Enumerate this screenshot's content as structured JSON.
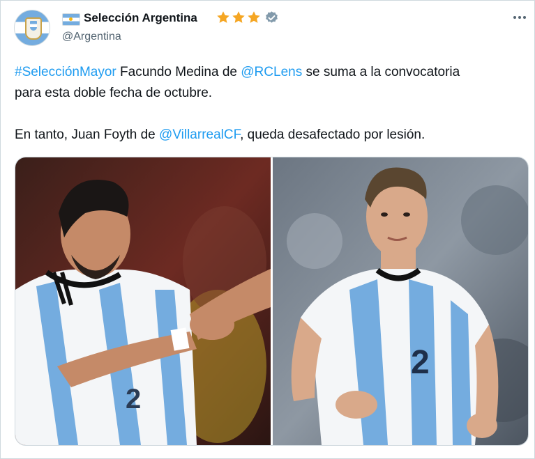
{
  "author": {
    "display_name": "Selección Argentina",
    "handle": "@Argentina",
    "stars": 3,
    "avatar_icon": "afa-crest-icon",
    "flag_icon": "argentina-flag-icon",
    "verified_icon": "verified-badge-icon"
  },
  "menu": {
    "icon": "more-options-icon"
  },
  "tweet": {
    "line1": {
      "hashtag": "#SelecciónMayor",
      "text_a": " Facundo Medina de ",
      "mention": "@RCLens",
      "text_b": " se suma a la convocatoria"
    },
    "line2": "para esta doble fecha de octubre.",
    "line3": {
      "text_a": "En tanto, Juan Foyth de ",
      "mention": "@VillarrealCF",
      "text_b": ", queda desafectado por lesión."
    }
  },
  "colors": {
    "link": "#1d9bf0",
    "text": "#0f1419",
    "secondary": "#536471",
    "star": "#f5a623",
    "jersey_blue": "#74acdf"
  }
}
